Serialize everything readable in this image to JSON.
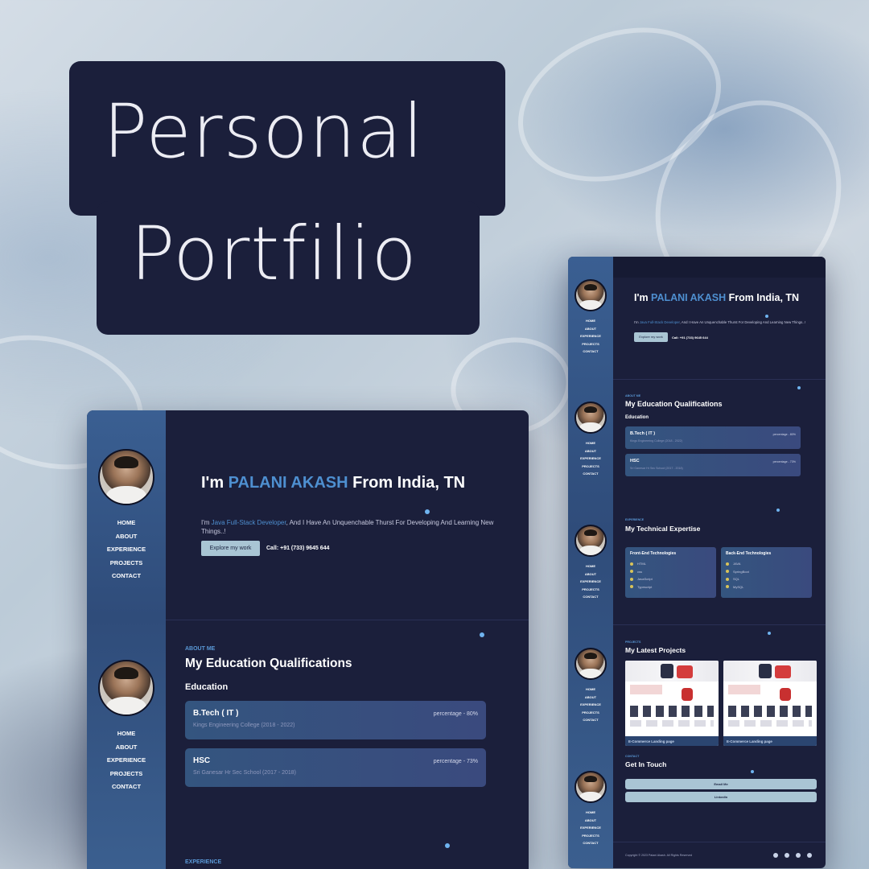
{
  "promo": {
    "title_line1": "Personal",
    "title_line2": "Portfilio"
  },
  "nav": [
    "HOME",
    "ABOUT",
    "EXPERIENCE",
    "PROJECTS",
    "CONTACT"
  ],
  "hero": {
    "greeting": "I'm ",
    "name": "PALANI AKASH",
    "location": " From India, TN",
    "sub_prefix": "I'm ",
    "role": "Java Full-Stack Developer",
    "sub_suffix": ", And I Have An Unquenchable Thurst For Developing And Learning New Things..!",
    "button_label": "Explore my work",
    "call": "Call: +91 (733) 9645 644"
  },
  "about": {
    "eyebrow": "ABOUT ME",
    "title": "My Education Qualifications",
    "subheading": "Education",
    "entries": [
      {
        "degree": "B.Tech ( IT )",
        "percentage": "percentage - 80%",
        "institution": "Kings Engineering College (2018 - 2022)"
      },
      {
        "degree": "HSC",
        "percentage": "percentage - 73%",
        "institution": "Sri Ganesar Hr Sec School (2017 - 2018)"
      }
    ]
  },
  "experience": {
    "eyebrow": "EXPERIENCE",
    "title": "My Technical Expertise",
    "frontend": {
      "heading": "Front-End Technologies",
      "items": [
        "HTML",
        "css",
        "JavaScript",
        "Typescript"
      ]
    },
    "backend": {
      "heading": "Back-End Technologies",
      "items": [
        "JAVA",
        "SpringBoot",
        "SQL",
        "MySQL"
      ]
    }
  },
  "projects": {
    "eyebrow": "PROJECTS",
    "title": "My Latest Projects",
    "items": [
      "E-Commerce Landing page",
      "E-Commerce Landing page"
    ]
  },
  "contact": {
    "eyebrow": "CONTACT",
    "title": "Get In Touch",
    "email_button": "Email Me",
    "linkedin_button": "LinkedIn"
  },
  "footer": {
    "copyright": "Copyright © 2023 Palani Akash. All Rights Reserved",
    "social_icons": [
      "linkedin-icon",
      "instagram-icon",
      "github-icon",
      "mail-icon"
    ]
  },
  "colors": {
    "navy": "#1b1f3b",
    "accent": "#4e8fd0",
    "button": "#a9c5d4",
    "sidebar": "#3a5f92"
  }
}
